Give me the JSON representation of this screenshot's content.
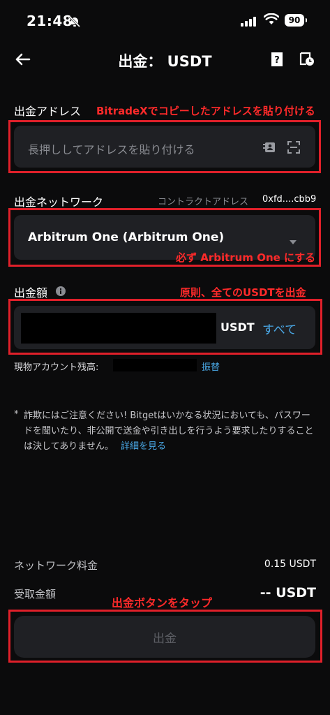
{
  "status_bar": {
    "time": "21:48",
    "battery": "90"
  },
  "header": {
    "title": "出金：  USDT"
  },
  "address": {
    "label": "出金アドレス",
    "note": "BitradeXでコピーしたアドレスを貼り付ける",
    "placeholder": "長押ししてアドレスを貼り付ける"
  },
  "network": {
    "label": "出金ネットワーク",
    "contract_label": "コントラクトアドレス",
    "contract_value": "0xfd....cbb9",
    "selected": "Arbitrum One (Arbitrum One)",
    "note": "必ず Arbitrum One にする"
  },
  "amount": {
    "label": "出金額",
    "note": "原則、全てのUSDTを出金",
    "currency": "USDT",
    "all_label": "すべて",
    "balance_label": "現物アカウント残高:",
    "transfer_label": "振替"
  },
  "warning": {
    "asterisk": "*",
    "text": "詐欺にはご注意ください! Bitgetはいかなる状況においても、パスワードを聞いたり、非公開で送金や引き出しを行うよう要求したりすることは決してありません。",
    "link": "詳細を見る"
  },
  "fees": {
    "network_fee_label": "ネットワーク料金",
    "network_fee_value": "0.15 USDT",
    "receive_label": "受取金額",
    "receive_value": "-- USDT"
  },
  "submit": {
    "note": "出金ボタンをタップ",
    "label": "出金"
  },
  "colors": {
    "accent_red": "#e0202a",
    "link_blue": "#4aa8e6",
    "field_bg": "#1f2024"
  }
}
